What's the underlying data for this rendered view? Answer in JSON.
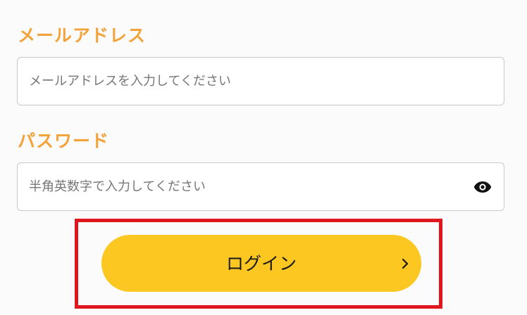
{
  "email": {
    "label": "メールアドレス",
    "placeholder": "メールアドレスを入力してください",
    "value": ""
  },
  "password": {
    "label": "パスワード",
    "placeholder": "半角英数字で入力してください",
    "value": "",
    "toggle_icon": "eye-icon"
  },
  "login": {
    "label": "ログイン",
    "icon": "chevron-right-icon"
  },
  "colors": {
    "label": "#f3a33a",
    "button": "#fdc722",
    "highlight": "#e0161e",
    "border": "#c9c9c9"
  }
}
